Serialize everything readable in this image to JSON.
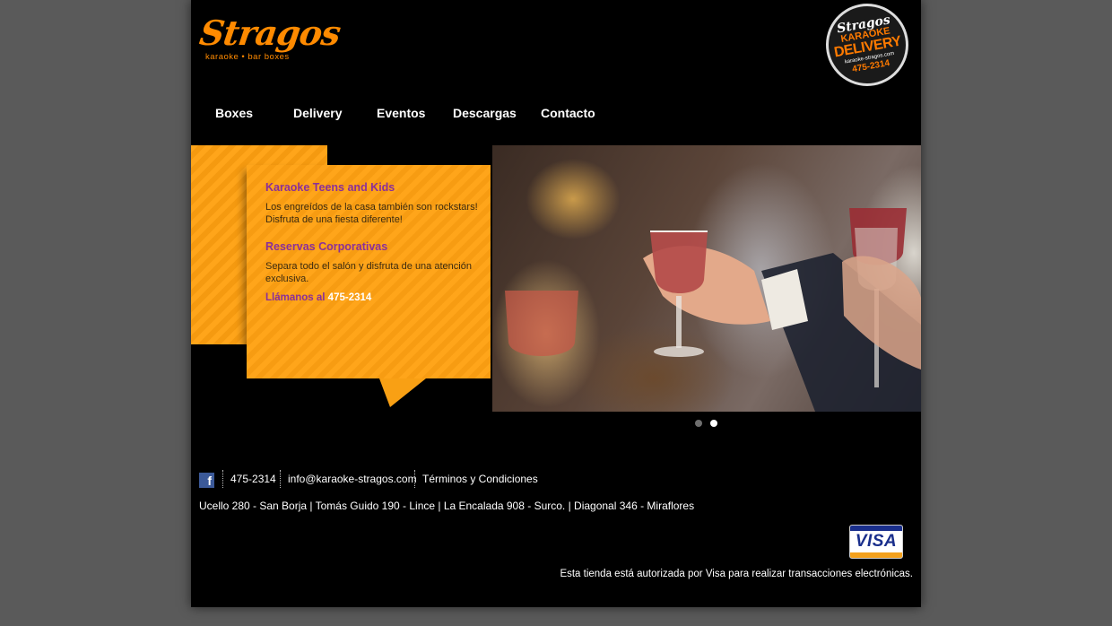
{
  "brand": {
    "logo_word": "Stragos",
    "logo_tagline": "karaoke • bar boxes",
    "badge": {
      "line1": "Stragos",
      "line2": "KARAOKE",
      "line3": "DELIVERY",
      "line4": "karaoke-stragos.com",
      "line5": "475-2314"
    }
  },
  "nav": {
    "items": [
      "Boxes",
      "Delivery",
      "Eventos",
      "Descargas",
      "Contacto"
    ]
  },
  "promo": {
    "heading1": "Karaoke Teens and Kids",
    "text1": "Los engreídos de la casa también son rockstars! Disfruta de una fiesta diferente!",
    "heading2": "Reservas Corporativas",
    "text2": "Separa todo el salón y disfruta de una atención exclusiva.",
    "call_label": "Llámanos al",
    "call_number": "475-2314"
  },
  "slider": {
    "dots": [
      "inactive",
      "active"
    ],
    "colors": {
      "inactive": "#6e6e6e",
      "active": "#ffffff"
    }
  },
  "footer": {
    "phone": "475-2314",
    "email": "info@karaoke-stragos.com",
    "terms": "Términos y Condiciones",
    "addresses": "Ucello 280 - San Borja | Tomás Guido 190 - Lince | La Encalada 908 - Surco. | Diagonal 346 - Miraflores",
    "visa_logo": "VISA",
    "visa_note": "Esta tienda está autorizada por Visa para realizar transacciones electrónicas."
  },
  "colors": {
    "page_bg": "#000000",
    "outer_bg": "#5a5a5a",
    "accent_orange": "#ff8a00",
    "promo_heading": "#8a2f9a"
  }
}
